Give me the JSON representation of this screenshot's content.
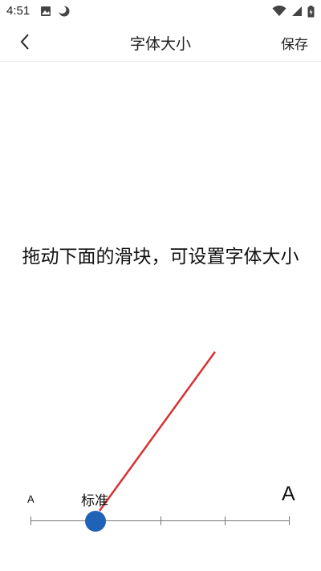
{
  "status_bar": {
    "time": "4:51",
    "left_icons": [
      "image-icon",
      "moon-icon"
    ],
    "right_icons": [
      "wifi-icon",
      "signal-icon",
      "battery-icon"
    ]
  },
  "app_bar": {
    "back_icon": "chevron-left-icon",
    "title": "字体大小",
    "save_label": "保存"
  },
  "preview": {
    "instruction": "拖动下面的滑块，可设置字体大小"
  },
  "slider": {
    "small_label": "A",
    "standard_label": "标准",
    "large_label": "A",
    "positions": 5,
    "selected_index": 1,
    "accent_color": "#1e63b8"
  },
  "annotation": {
    "color": "#d93030"
  }
}
